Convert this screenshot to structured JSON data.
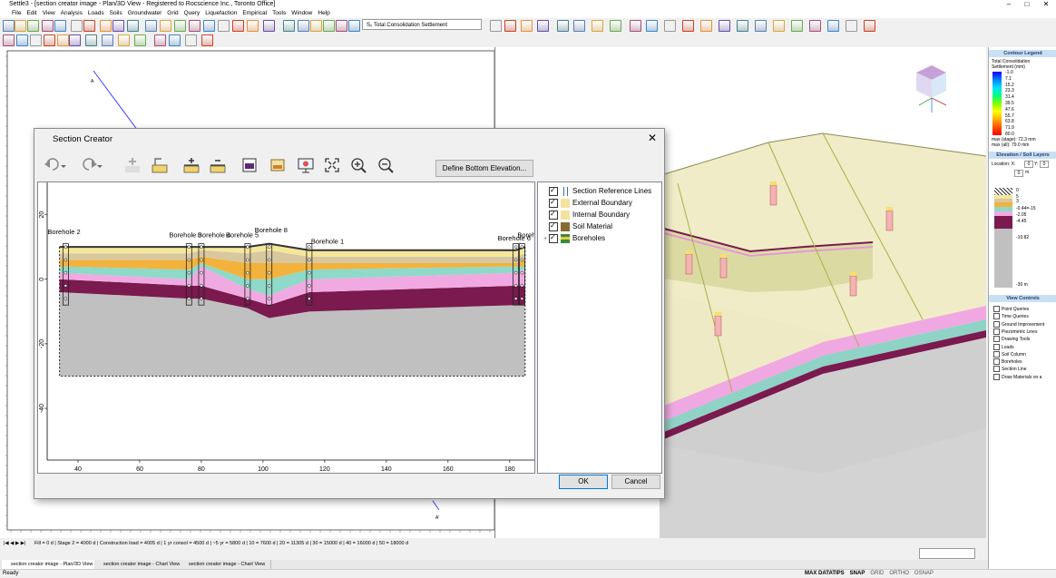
{
  "window": {
    "title": "Settle3 - [section creator image - Plan/3D View - Registered to Rocscience Inc., Toronto Office]",
    "minimize": "–",
    "maximize": "□",
    "close": "✕"
  },
  "menu": [
    "File",
    "Edit",
    "View",
    "Analysis",
    "Loads",
    "Soils",
    "Groundwater",
    "Grid",
    "Query",
    "Liquefaction",
    "Empirical",
    "Tools",
    "Window",
    "Help"
  ],
  "toolbar": {
    "result_select": "S₀  Total Consolidation Settlement"
  },
  "dialog": {
    "title": "Section Creator",
    "close": "✕",
    "define_button": "Define Bottom Elevation...",
    "ok": "OK",
    "cancel": "Cancel",
    "layers_tree": [
      {
        "label": "Section Reference Lines",
        "checked": true,
        "expandable": false
      },
      {
        "label": "External Boundary",
        "checked": true,
        "expandable": false
      },
      {
        "label": "Internal Boundary",
        "checked": true,
        "expandable": false
      },
      {
        "label": "Soil Material",
        "checked": true,
        "expandable": false
      },
      {
        "label": "Boreholes",
        "checked": true,
        "expandable": true
      }
    ]
  },
  "chart_data": {
    "type": "section",
    "x_ticks": [
      "40",
      "60",
      "80",
      "100",
      "120",
      "140",
      "160",
      "180"
    ],
    "y_ticks": [
      "20",
      "0",
      "-20",
      "-40"
    ],
    "xlim": [
      30,
      188
    ],
    "ylim": [
      -56,
      30
    ],
    "boreholes": [
      {
        "name": "Borehole 2",
        "x": 36
      },
      {
        "name": "Borehole 3",
        "x": 76
      },
      {
        "name": "Borehole 4",
        "x": 80
      },
      {
        "name": "Borehole 5",
        "x": 95
      },
      {
        "name": "Borehole 8",
        "x": 102
      },
      {
        "name": "Borehole 1",
        "x": 115
      },
      {
        "name": "Borehole 6",
        "x": 182
      },
      {
        "name": "Borehole 7",
        "x": 184
      }
    ]
  },
  "plan_labels": {
    "a": "A",
    "a_prime": "A'"
  },
  "side_panel": {
    "contour_legend": {
      "title": "Contour Legend",
      "subtitle1": "Total Consolidation",
      "subtitle2": "Settlement (mm)",
      "values": [
        "-1.0",
        "7.1",
        "15.2",
        "23.3",
        "31.4",
        "39.5",
        "47.6",
        "55.7",
        "63.8",
        "71.9",
        "80.0"
      ],
      "max_stage": "max (stage): 72.3 mm",
      "max_all": "max (all):   79.0 mm"
    },
    "elevation": {
      "title": "Elevation / Soil Layers",
      "location_label": "Location: X:",
      "x_value": "0",
      "y_label": "Y:",
      "y_value": "0",
      "z_value": "0",
      "unit": "m",
      "labels": [
        "0",
        "5",
        "3",
        "-0.44=-15",
        "-2.05",
        "-4.45",
        "-10.82",
        "-30 m"
      ]
    },
    "view_controls": {
      "title": "View Controls",
      "items": [
        "Point Queries",
        "Time Queries",
        "Ground Improvement",
        "Piezometric Lines",
        "Drawing Tools",
        "Loads",
        "Soil Column",
        "Boreholes",
        "Section Line",
        "Draw Materials on a"
      ]
    }
  },
  "chart_bar": "Fill = 0 d   |  Stage 2 = 4000 d   |  Construction load = 4005 d  |  1 yr consol = 4500 d  |  ~5 yr = 5800 d  |  10 = 7600 d  |  20 = 11305 d  |  30 = 15000 d  |  40 = 16000 d  |  50 = 18000 d",
  "doc_tabs": [
    "section creator image - Plan/3D View",
    "section creator image - Chart View",
    "section creator image - Chart View"
  ],
  "status": {
    "ready": "Ready",
    "items": [
      "MAX DATATIPS",
      "SNAP",
      "GRID",
      "ORTHO",
      "OSNAP"
    ]
  },
  "colors": {
    "accent": "#0078d7",
    "base_soil": "#c0c0c0",
    "maroon": "#7a1a4e",
    "pink": "#f1a9e1",
    "teal": "#8fd9c8",
    "orange": "#f2b23c",
    "yellow": "#f5e79a",
    "tan": "#d8c8a0"
  }
}
